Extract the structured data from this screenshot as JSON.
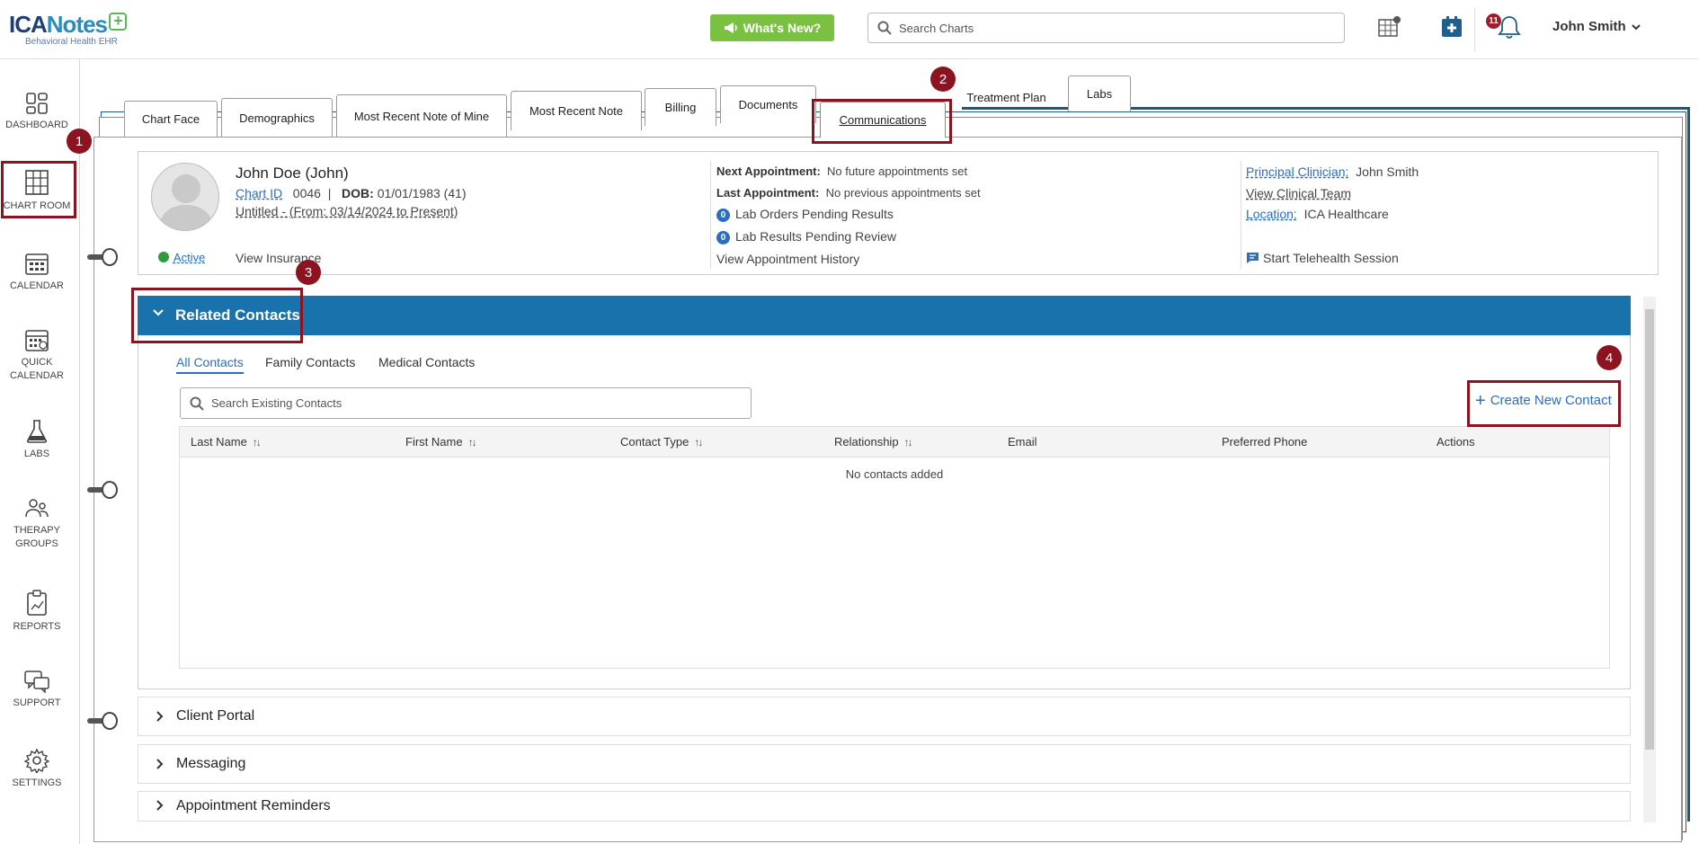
{
  "logo": {
    "brand_a": "ICA",
    "brand_b": "Notes",
    "plus": "+",
    "tagline": "Behavioral Health EHR"
  },
  "header": {
    "whats_new_label": "What's New?",
    "search_placeholder": "Search Charts",
    "notification_count": "11",
    "user_name": "John Smith"
  },
  "nav": {
    "items": [
      {
        "label": "DASHBOARD",
        "icon": "dashboard-icon"
      },
      {
        "label": "CHART ROOM",
        "icon": "chart-room-icon"
      },
      {
        "label": "CALENDAR",
        "icon": "calendar-icon"
      },
      {
        "label": "QUICK CALENDAR",
        "icon": "quick-calendar-icon"
      },
      {
        "label": "LABS",
        "icon": "flask-icon"
      },
      {
        "label": "THERAPY GROUPS",
        "icon": "group-icon"
      },
      {
        "label": "REPORTS",
        "icon": "reports-icon"
      },
      {
        "label": "SUPPORT",
        "icon": "support-icon"
      },
      {
        "label": "SETTINGS",
        "icon": "gear-icon"
      }
    ]
  },
  "markers": [
    "1",
    "2",
    "3",
    "4"
  ],
  "tabs": [
    {
      "label": "Chart Face"
    },
    {
      "label": "Demographics"
    },
    {
      "label": "Most Recent Note of Mine"
    },
    {
      "label": "Most Recent Note"
    },
    {
      "label": "Billing"
    },
    {
      "label": "Documents"
    },
    {
      "label": "Communications",
      "active": true
    },
    {
      "label": "Treatment Plan"
    },
    {
      "label": "Labs"
    }
  ],
  "patient": {
    "name": "John Doe (John)",
    "chart_id_label": "Chart ID",
    "chart_id": "0046",
    "sep": "|",
    "dob_label": "DOB:",
    "dob": "01/01/1983 (41)",
    "episode": "Untitled - (From: 03/14/2024 to Present)",
    "status": "Active",
    "view_insurance": "View Insurance",
    "next_appt_label": "Next Appointment:",
    "next_appt": "No future appointments set",
    "last_appt_label": "Last Appointment:",
    "last_appt": "No previous appointments set",
    "lab_orders_count": "0",
    "lab_orders": "Lab Orders Pending Results",
    "lab_results_count": "0",
    "lab_results": "Lab Results Pending Review",
    "view_appt_history": "View Appointment History",
    "principal_label": "Principal Clinician:",
    "principal": "John Smith",
    "view_team": "View Clinical Team",
    "location_label": "Location:",
    "location": "ICA Healthcare",
    "telehealth": "Start Telehealth Session"
  },
  "related_contacts": {
    "title": "Related Contacts",
    "subtabs": [
      "All Contacts",
      "Family Contacts",
      "Medical Contacts"
    ],
    "search_placeholder": "Search Existing Contacts",
    "create_label": "Create New Contact",
    "create_plus": "+",
    "sort_glyph": "↑↓",
    "columns": [
      "Last Name",
      "First Name",
      "Contact Type",
      "Relationship",
      "Email",
      "Preferred Phone",
      "Actions"
    ],
    "empty_text": "No contacts added"
  },
  "sections": [
    "Client Portal",
    "Messaging",
    "Appointment Reminders"
  ],
  "colors": {
    "accent": "#1a72ad",
    "link": "#2a6ec0",
    "marker": "#8b1420",
    "whats_new": "#7ac142",
    "active": "#2e9b3c"
  }
}
